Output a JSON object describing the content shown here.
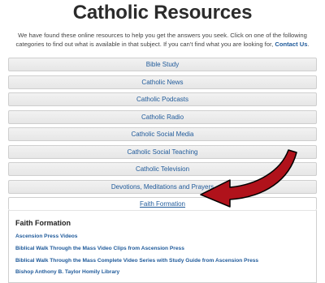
{
  "page": {
    "title": "Catholic Resources",
    "intro_text": "We have found these online resources to help you get the answers you seek. Click on one of the following categories to find out what is available in that subject. If you can't find what you are looking for,",
    "contact_link": "Contact Us",
    "intro_end": "."
  },
  "accordion": {
    "items": [
      {
        "label": "Bible Study"
      },
      {
        "label": "Catholic News"
      },
      {
        "label": "Catholic Podcasts"
      },
      {
        "label": "Catholic Radio"
      },
      {
        "label": "Catholic Social Media"
      },
      {
        "label": "Catholic Social Teaching"
      },
      {
        "label": "Catholic Television"
      },
      {
        "label": "Devotions, Meditations and Prayers"
      },
      {
        "label": "Faith Formation"
      }
    ],
    "active_index": 8
  },
  "panel": {
    "heading": "Faith Formation",
    "links": [
      "Ascension Press Videos",
      "Biblical Walk Through the Mass Video Clips from Ascension Press",
      "Biblical Walk Through the Mass Complete Video Series with Study Guide from Ascension Press",
      "Bishop Anthony B. Taylor Homily Library"
    ]
  },
  "colors": {
    "link": "#1f5a9a",
    "arrow": "#b0121b"
  },
  "annotation": {
    "icon": "red-arrow-icon"
  }
}
